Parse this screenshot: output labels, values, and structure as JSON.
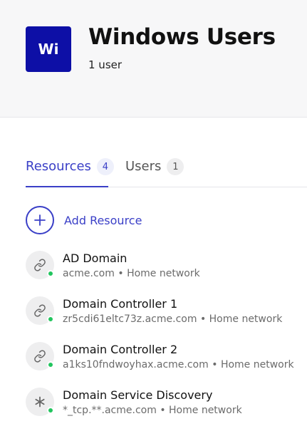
{
  "header": {
    "avatar_initials": "Wi",
    "avatar_color": "#0d0fa6",
    "title": "Windows Users",
    "subtitle": "1 user"
  },
  "tabs": [
    {
      "label": "Resources",
      "count": "4",
      "active": true
    },
    {
      "label": "Users",
      "count": "1",
      "active": false
    }
  ],
  "add_resource": {
    "label": "Add Resource",
    "icon": "plus-icon"
  },
  "resources": [
    {
      "name": "AD Domain",
      "address": "acme.com",
      "network": "Home network",
      "separator": "•",
      "icon": "link-icon",
      "status": "online"
    },
    {
      "name": "Domain Controller 1",
      "address": "zr5cdi61eltc73z.acme.com",
      "network": "Home network",
      "separator": "•",
      "icon": "link-icon",
      "status": "online"
    },
    {
      "name": "Domain Controller 2",
      "address": "a1ks10fndwoyhax.acme.com",
      "network": "Home network",
      "separator": "•",
      "icon": "link-icon",
      "status": "online"
    },
    {
      "name": "Domain Service Discovery",
      "address": "*_tcp.**.acme.com",
      "network": "Home network",
      "separator": "•",
      "icon": "asterisk-icon",
      "status": "online"
    }
  ],
  "colors": {
    "accent": "#3a3fc7",
    "status_online": "#22c55e"
  }
}
